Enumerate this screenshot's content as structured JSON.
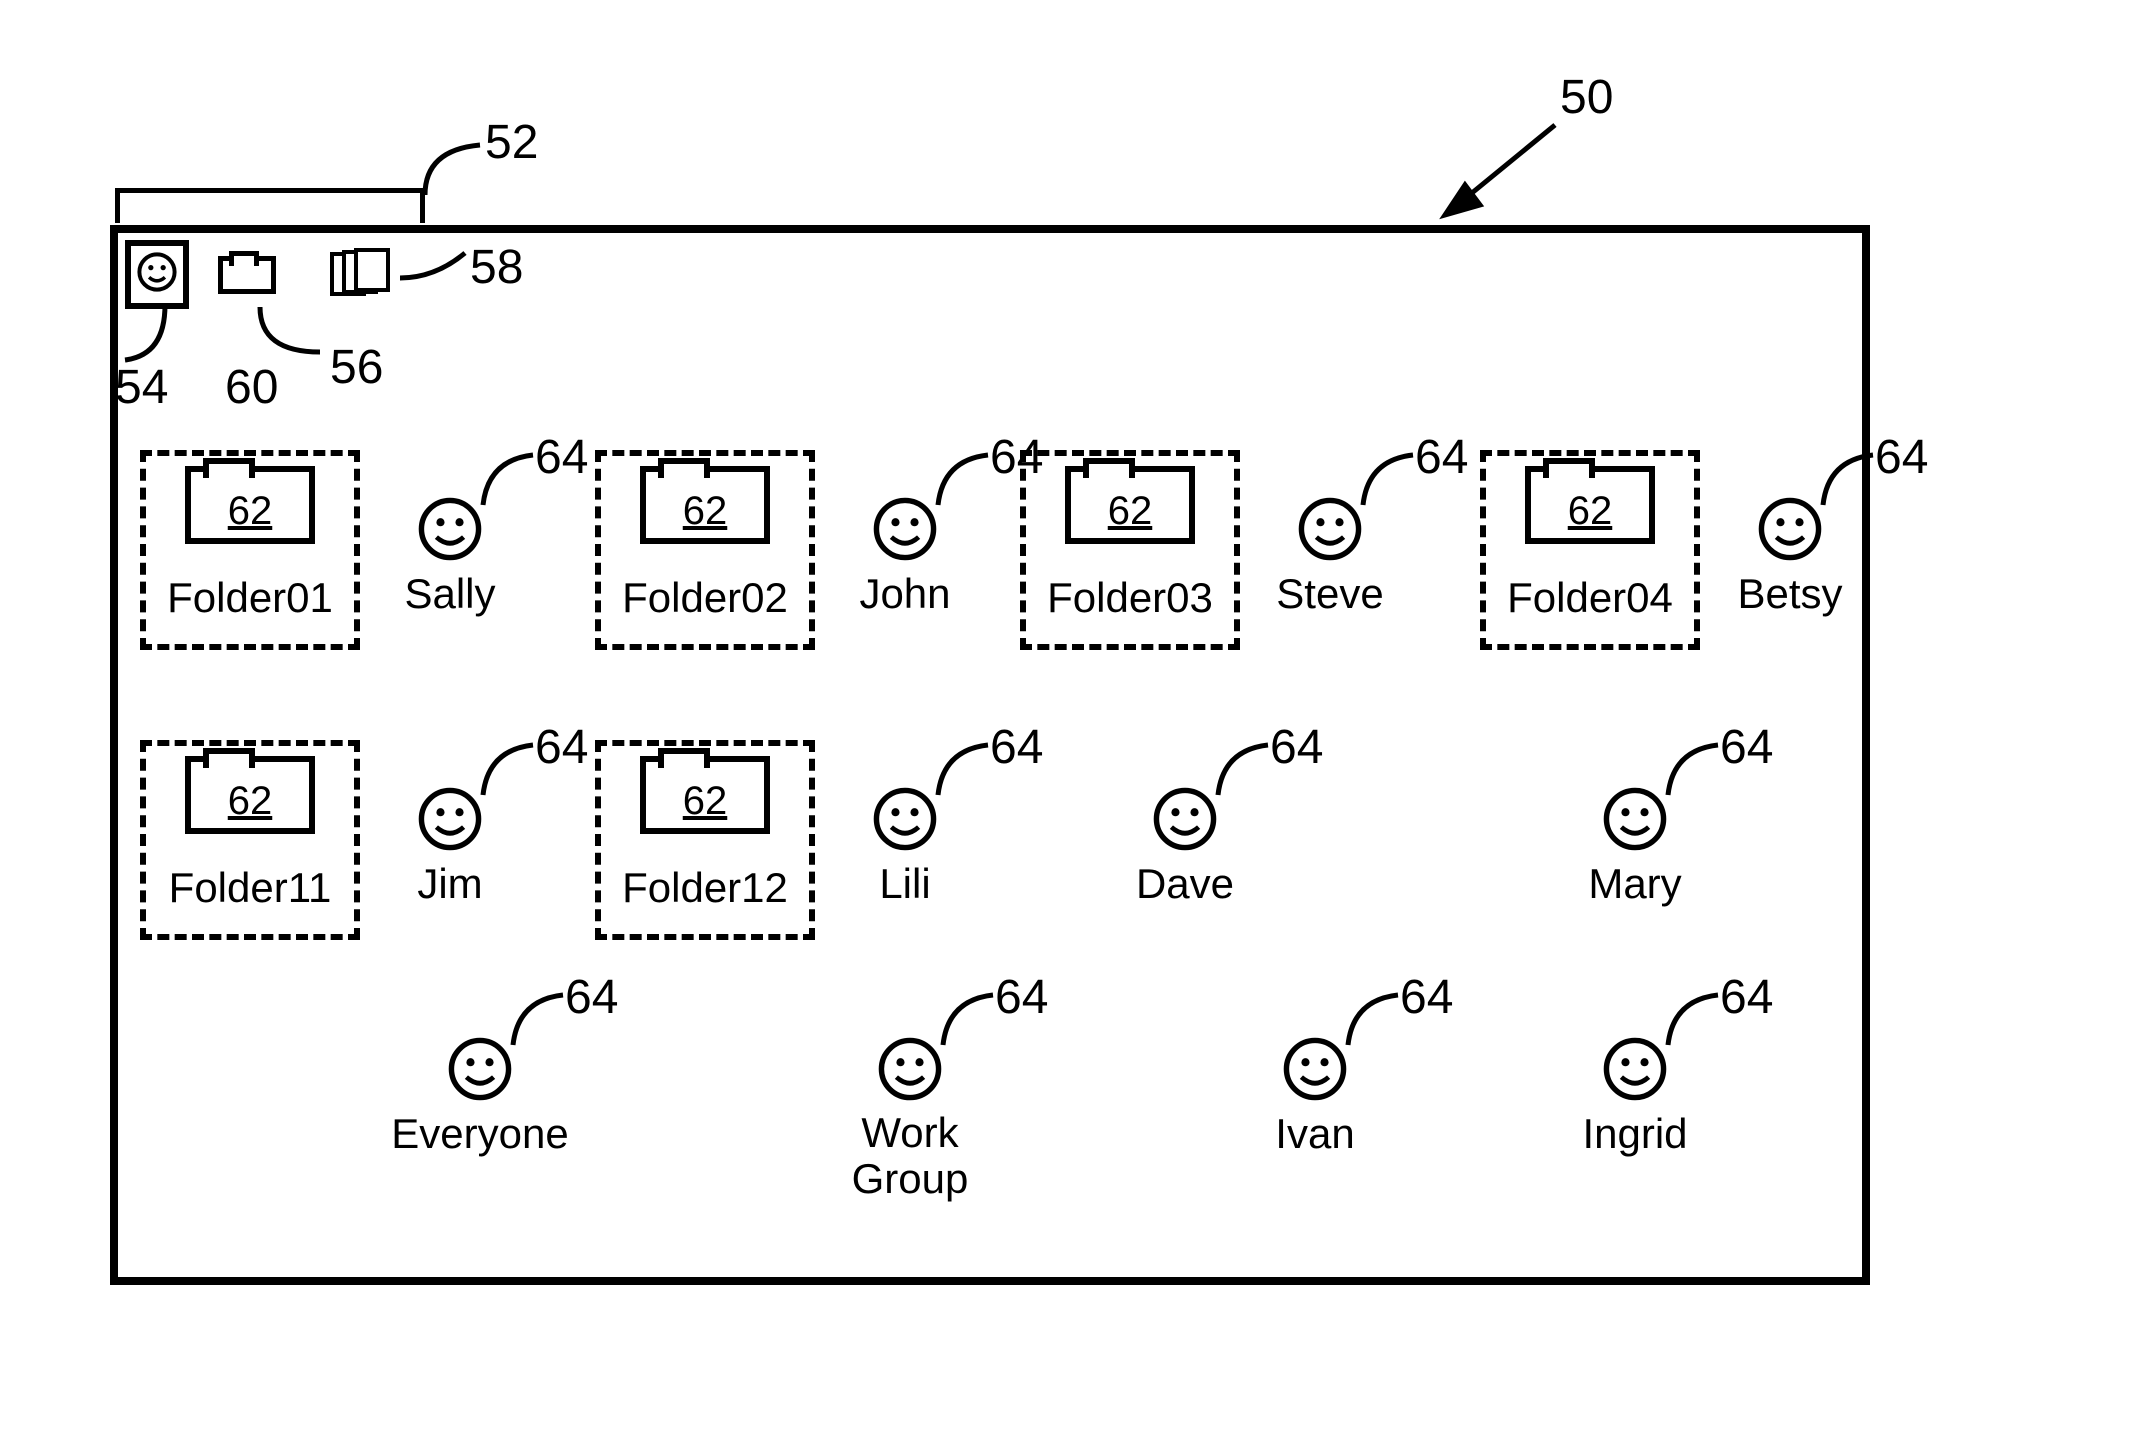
{
  "refs": {
    "window": "50",
    "toolbar": "52",
    "smile_btn": "54",
    "folder_btn": "56",
    "stack_btn": "58",
    "row_label": "60",
    "folder_inner": "62",
    "person_ref": "64"
  },
  "toolbar": {
    "smile_name": "people-view-button",
    "folder_name": "folder-view-button",
    "stack_name": "files-view-button"
  },
  "row1": [
    {
      "folder": "Folder01",
      "person": "Sally"
    },
    {
      "folder": "Folder02",
      "person": "John"
    },
    {
      "folder": "Folder03",
      "person": "Steve"
    },
    {
      "folder": "Folder04",
      "person": "Betsy"
    }
  ],
  "row2": [
    {
      "folder": "Folder11",
      "person": "Jim"
    },
    {
      "folder": "Folder12",
      "person": "Lili"
    },
    {
      "folder": null,
      "person": "Dave"
    },
    {
      "folder": null,
      "person": "Mary"
    }
  ],
  "row3": [
    {
      "person": "Everyone"
    },
    {
      "person": "Work Group"
    },
    {
      "person": "Ivan"
    },
    {
      "person": "Ingrid"
    }
  ]
}
